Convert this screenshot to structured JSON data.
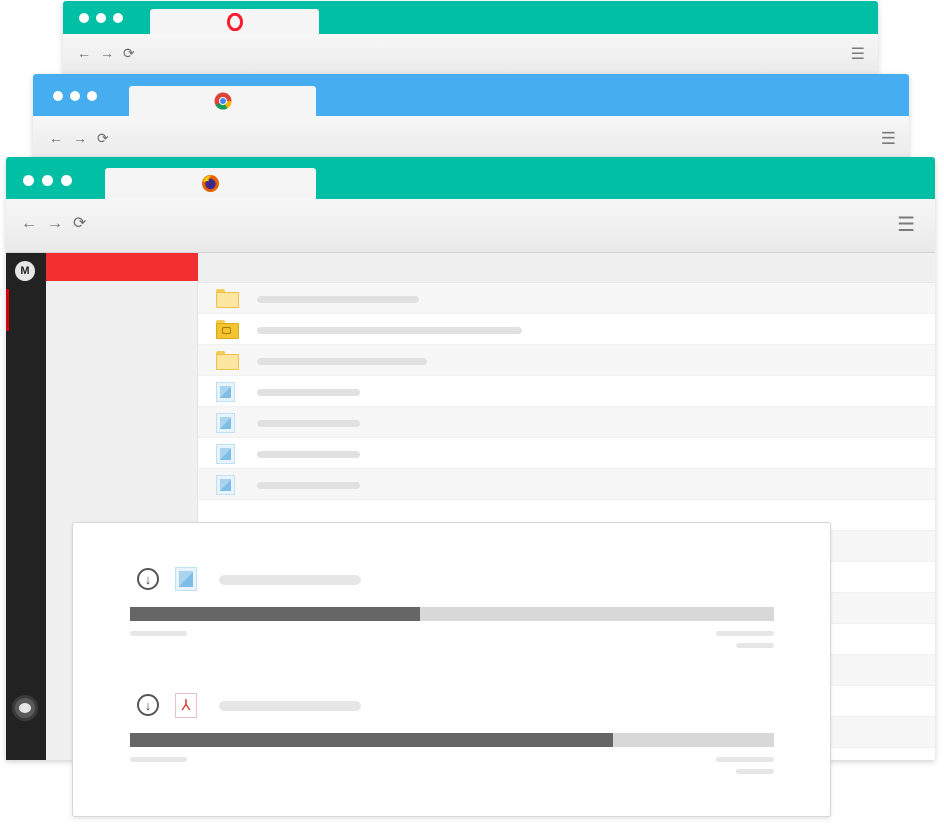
{
  "windows": [
    {
      "id": "opera",
      "accent": "#00bfa5",
      "tab_icon": "opera-icon",
      "nav_icons": [
        "back-arrow-icon",
        "forward-arrow-icon",
        "reload-icon"
      ],
      "menu_icon": "hamburger-menu-icon"
    },
    {
      "id": "chrome",
      "accent": "#46aef0",
      "tab_icon": "chrome-icon",
      "nav_icons": [
        "back-arrow-icon",
        "forward-arrow-icon",
        "reload-icon"
      ],
      "menu_icon": "hamburger-menu-icon"
    },
    {
      "id": "firefox",
      "accent": "#00bfa5",
      "tab_icon": "firefox-icon",
      "nav_icons": [
        "back-arrow-icon",
        "forward-arrow-icon",
        "reload-icon"
      ],
      "menu_icon": "hamburger-menu-icon"
    }
  ],
  "glyphs": {
    "back": "←",
    "forward": "→",
    "reload": "⟳",
    "menu": "☰",
    "mega": "M",
    "download": "↓",
    "pdf": "⅄"
  },
  "app": {
    "logo_icon": "mega-logo-icon",
    "sidebar_accent": "#f23030",
    "file_rows": [
      {
        "icon": "folder-icon",
        "name_bar": 0.22
      },
      {
        "icon": "camera-folder-icon",
        "name_bar": 0.36
      },
      {
        "icon": "folder-icon",
        "name_bar": 0.23
      },
      {
        "icon": "image-file-icon",
        "name_bar": 0.14
      },
      {
        "icon": "image-file-icon",
        "name_bar": 0.14
      },
      {
        "icon": "image-file-icon",
        "name_bar": 0.14
      },
      {
        "icon": "image-file-icon",
        "name_bar": 0.14
      }
    ]
  },
  "transfers": [
    {
      "type_icon": "image-file-icon",
      "progress": 0.45
    },
    {
      "type_icon": "pdf-file-icon",
      "progress": 0.75
    }
  ]
}
